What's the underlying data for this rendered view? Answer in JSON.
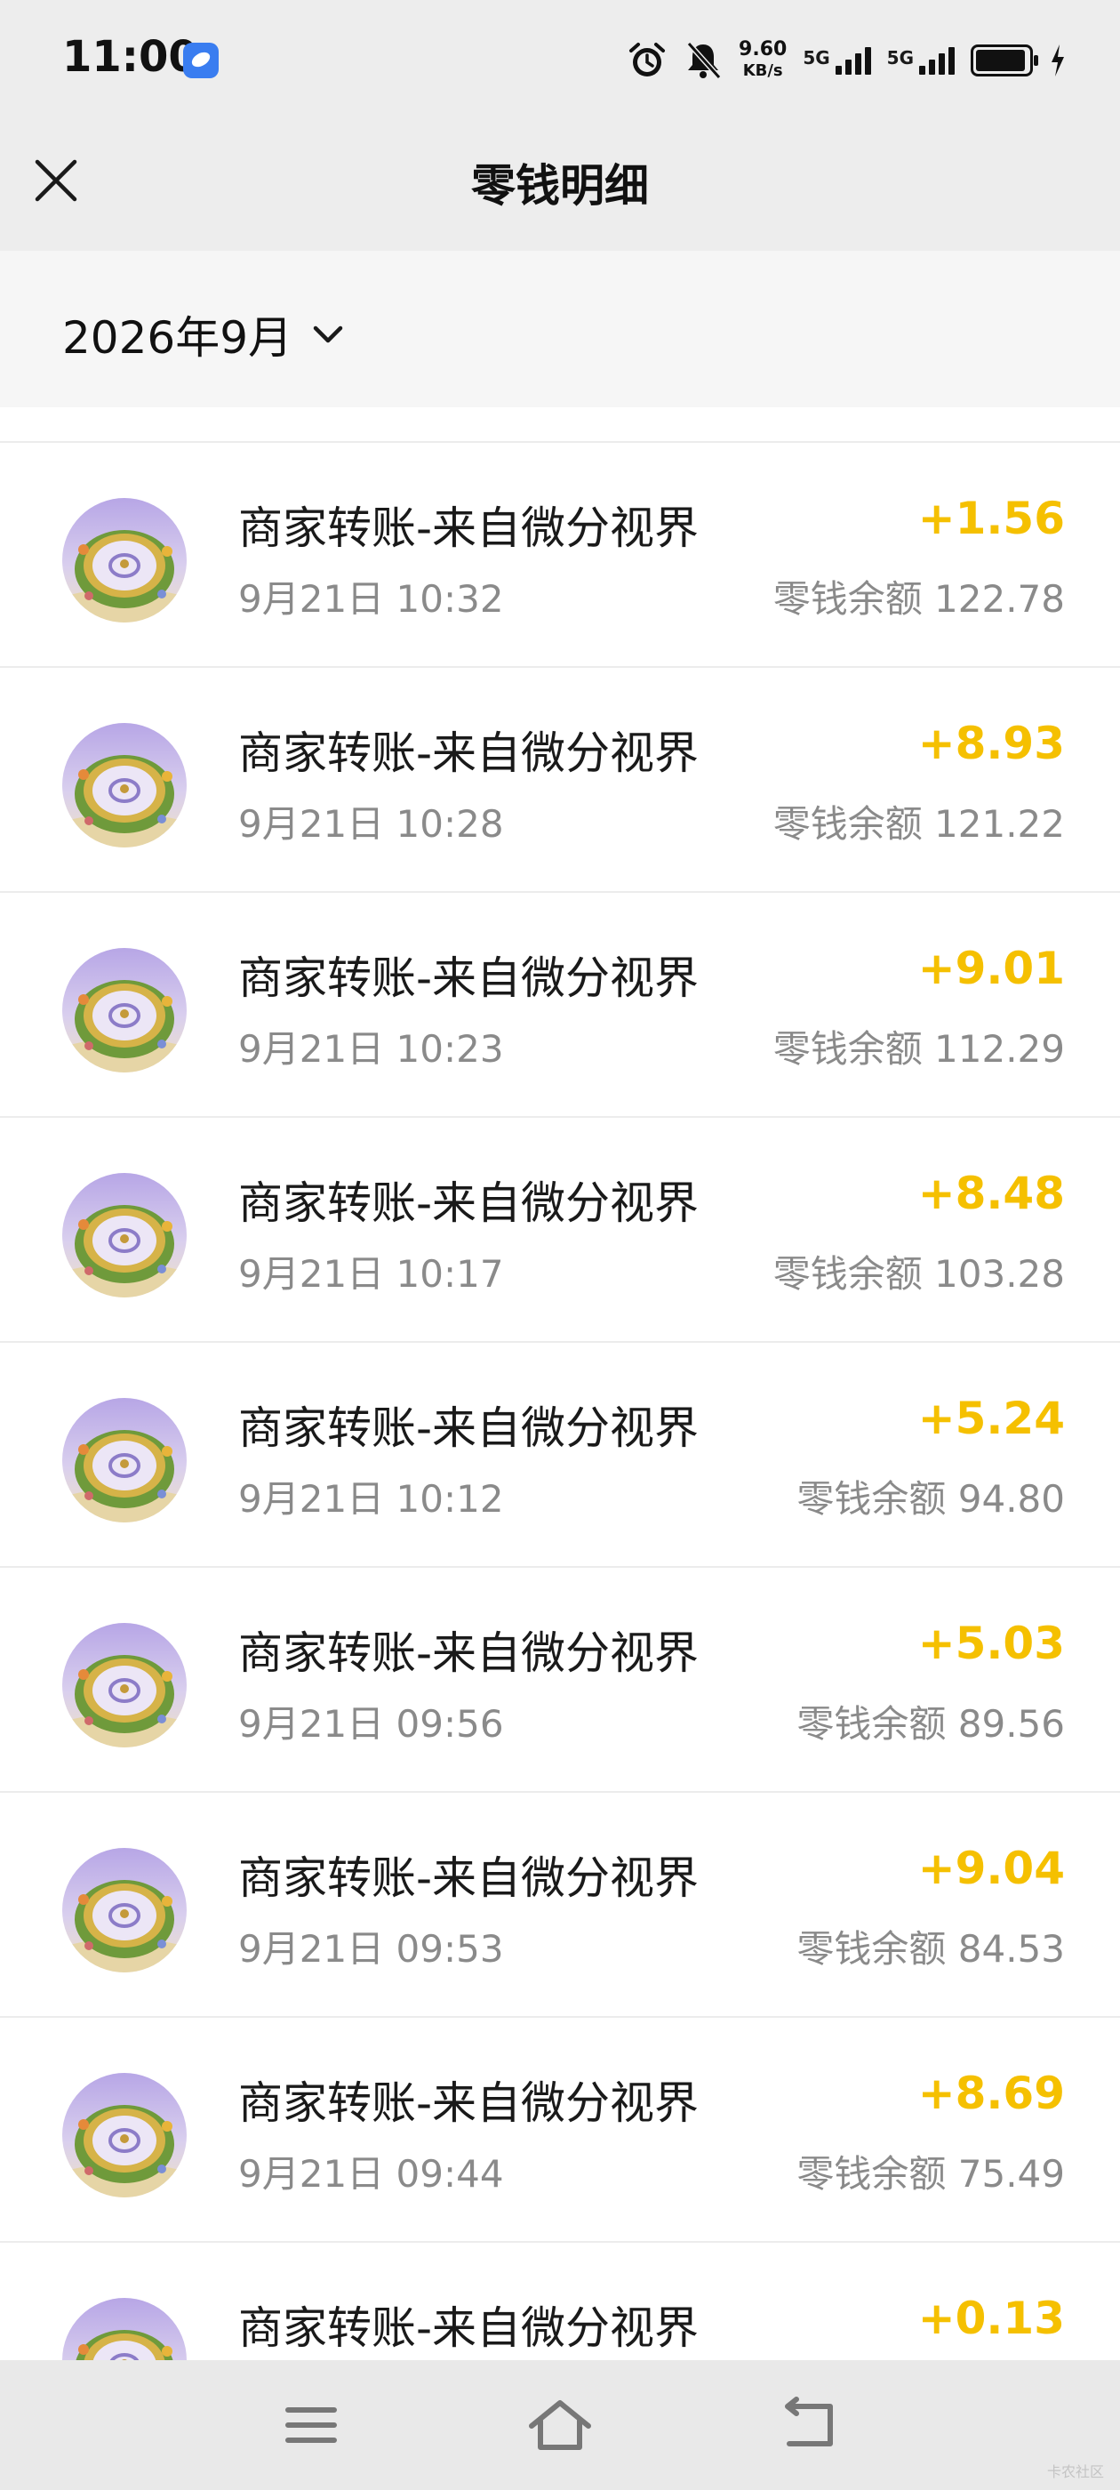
{
  "status_bar": {
    "time": "11:00",
    "net_speed_value": "9.60",
    "net_speed_unit": "KB/s",
    "sim1_label": "5G",
    "sim2_label": "5G",
    "icons": [
      "app-icon",
      "alarm-icon",
      "bell-muted-icon",
      "signal-icon",
      "battery-icon",
      "charging-icon"
    ]
  },
  "header": {
    "title": "零钱明细",
    "close_icon": "close-icon"
  },
  "filter": {
    "month": "2026年9月",
    "dropdown_icon": "chevron-down-icon"
  },
  "transactions": [
    {
      "title": "商家转账-来自微分视界",
      "time": "9月21日 10:32",
      "amount": "+1.56",
      "balance": "零钱余额 122.78"
    },
    {
      "title": "商家转账-来自微分视界",
      "time": "9月21日 10:28",
      "amount": "+8.93",
      "balance": "零钱余额 121.22"
    },
    {
      "title": "商家转账-来自微分视界",
      "time": "9月21日 10:23",
      "amount": "+9.01",
      "balance": "零钱余额 112.29"
    },
    {
      "title": "商家转账-来自微分视界",
      "time": "9月21日 10:17",
      "amount": "+8.48",
      "balance": "零钱余额 103.28"
    },
    {
      "title": "商家转账-来自微分视界",
      "time": "9月21日 10:12",
      "amount": "+5.24",
      "balance": "零钱余额 94.80"
    },
    {
      "title": "商家转账-来自微分视界",
      "time": "9月21日 09:56",
      "amount": "+5.03",
      "balance": "零钱余额 89.56"
    },
    {
      "title": "商家转账-来自微分视界",
      "time": "9月21日 09:53",
      "amount": "+9.04",
      "balance": "零钱余额 84.53"
    },
    {
      "title": "商家转账-来自微分视界",
      "time": "9月21日 09:44",
      "amount": "+8.69",
      "balance": "零钱余额 75.49"
    },
    {
      "title": "商家转账-来自微分视界",
      "time": "",
      "amount": "+0.13",
      "balance": ""
    }
  ],
  "nav_bar": {
    "icons": [
      "menu-icon",
      "home-icon",
      "back-icon"
    ]
  },
  "watermark": "卡农社区",
  "colors": {
    "amount": "#f5c000",
    "header_bg": "#ededed",
    "secondary_text": "#8a8a8a"
  }
}
